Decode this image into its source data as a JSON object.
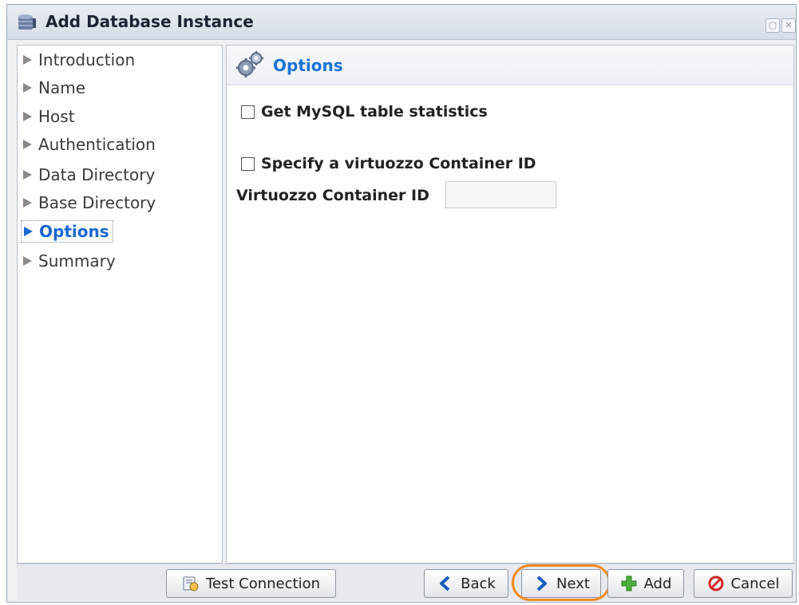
{
  "window": {
    "title": "Add Database Instance",
    "title_icon": "database-icon"
  },
  "sidebar": {
    "items": [
      {
        "label": "Introduction",
        "active": false
      },
      {
        "label": "Name",
        "active": false
      },
      {
        "label": "Host",
        "active": false
      },
      {
        "label": "Authentication",
        "active": false
      },
      {
        "label": "Data Directory",
        "active": false
      },
      {
        "label": "Base Directory",
        "active": false
      },
      {
        "label": "Options",
        "active": true
      },
      {
        "label": "Summary",
        "active": false
      }
    ]
  },
  "content": {
    "title": "Options",
    "title_icon": "gears-icon",
    "mysql_stats_label": "Get MySQL table statistics",
    "mysql_stats_checked": false,
    "virtuozzo_label": "Specify a virtuozzo Container ID",
    "virtuozzo_checked": false,
    "container_id_label": "Virtuozzo Container ID",
    "container_id_value": ""
  },
  "footer": {
    "test_connection": "Test Connection",
    "back": "Back",
    "next": "Next",
    "add": "Add",
    "cancel": "Cancel"
  },
  "colors": {
    "accent": "#1a73d9",
    "highlight": "#f08a1f"
  }
}
